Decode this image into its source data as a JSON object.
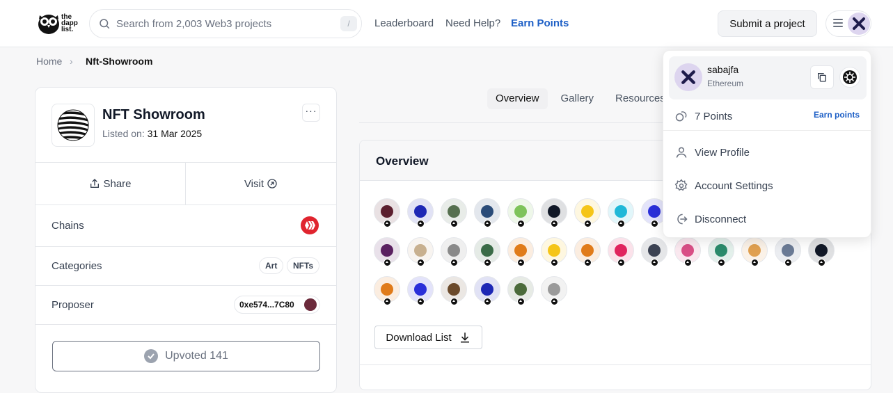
{
  "header": {
    "logo_text_lines": [
      "the",
      "dapp",
      "list."
    ],
    "search_placeholder": "Search from 2,003 Web3 projects",
    "search_shortcut": "/",
    "nav": {
      "leaderboard": "Leaderboard",
      "help": "Need Help?",
      "earn": "Earn Points"
    },
    "submit_label": "Submit a project"
  },
  "breadcrumb": {
    "home": "Home",
    "separator": "›",
    "current": "Nft-Showroom"
  },
  "project": {
    "name": "NFT Showroom",
    "listed_prefix": "Listed on: ",
    "listed_date": "31 Mar 2025",
    "more_label": "···",
    "share_label": "Share",
    "visit_label": "Visit",
    "chains_label": "Chains",
    "chain_color": "#e0242e",
    "categories_label": "Categories",
    "categories": [
      "Art",
      "NFTs"
    ],
    "proposer_label": "Proposer",
    "proposer_address": "0xe574...7C80",
    "upvote_label": "Upvoted 141"
  },
  "tabs": [
    "Overview",
    "Gallery",
    "Resources"
  ],
  "overview": {
    "title": "Overview",
    "download_label": "Download List",
    "avatar_rows": [
      [
        "#5b1e2e",
        "#1d27b5",
        "#56704f",
        "#2a4b78",
        "#7ec35a",
        "#111827",
        "#f5c518",
        "#1eb8d8",
        "#2a2fd9"
      ],
      [
        "#5a2060",
        "#c8b08f",
        "#8a8a8a",
        "#3a6b47",
        "#e07b1a",
        "#f5c518",
        "#e07b1a",
        "#e0245e",
        "#3b4252",
        "#d94f86",
        "#2a8b6b",
        "#e0a050",
        "#6a7a95",
        "#111827"
      ],
      [
        "#e07b1a",
        "#2a2fd9",
        "#6b4a2b",
        "#1d27b5",
        "#4b6b3a",
        "#9a9a9a"
      ]
    ]
  },
  "dropdown": {
    "username": "sabajfa",
    "network": "Ethereum",
    "points": "7 Points",
    "earn_points": "Earn points",
    "view_profile": "View Profile",
    "account_settings": "Account Settings",
    "disconnect": "Disconnect"
  },
  "colors": {
    "accent": "#1d5fc6",
    "brand_avatar": "#ddd5ef"
  },
  "icons": [
    "search-icon",
    "menu-icon",
    "chevron-right-icon",
    "share-icon",
    "external-link-icon",
    "download-icon",
    "copy-icon",
    "coins-icon",
    "user-icon",
    "gear-icon",
    "logout-icon",
    "check-icon"
  ]
}
